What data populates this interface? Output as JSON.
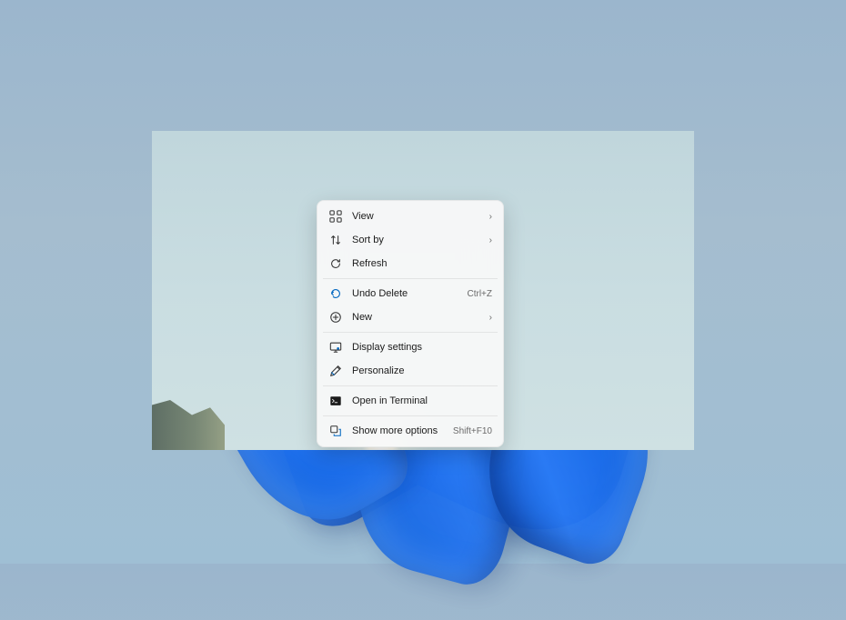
{
  "context_menu": {
    "items": [
      {
        "label": "View",
        "icon": "grid-icon",
        "submenu": true
      },
      {
        "label": "Sort by",
        "icon": "sort-icon",
        "submenu": true
      },
      {
        "label": "Refresh",
        "icon": "refresh-icon"
      }
    ],
    "items2": [
      {
        "label": "Undo Delete",
        "icon": "undo-icon",
        "hint": "Ctrl+Z",
        "accent": true
      },
      {
        "label": "New",
        "icon": "new-icon",
        "submenu": true
      }
    ],
    "items3": [
      {
        "label": "Display settings",
        "icon": "display-icon"
      },
      {
        "label": "Personalize",
        "icon": "personalize-icon"
      }
    ],
    "items4": [
      {
        "label": "Open in Terminal",
        "icon": "terminal-icon"
      }
    ],
    "items5": [
      {
        "label": "Show more options",
        "icon": "more-options-icon",
        "hint": "Shift+F10"
      }
    ]
  }
}
